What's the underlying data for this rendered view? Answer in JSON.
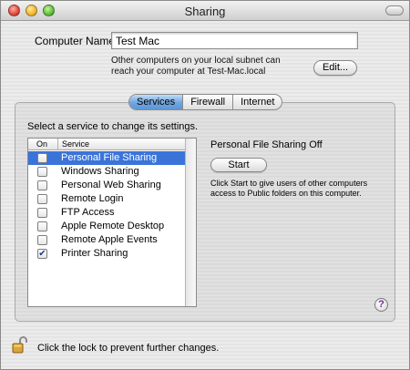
{
  "window": {
    "title": "Sharing"
  },
  "computer": {
    "label": "Computer Name:",
    "value": "Test Mac",
    "info": "Other computers on your local subnet can reach your computer at Test-Mac.local",
    "edit_label": "Edit..."
  },
  "tabs": [
    {
      "label": "Services",
      "active": true
    },
    {
      "label": "Firewall",
      "active": false
    },
    {
      "label": "Internet",
      "active": false
    }
  ],
  "services": {
    "hint": "Select a service to change its settings.",
    "col_on": "On",
    "col_service": "Service",
    "items": [
      {
        "name": "Personal File Sharing",
        "on": false,
        "selected": true
      },
      {
        "name": "Windows Sharing",
        "on": false,
        "selected": false
      },
      {
        "name": "Personal Web Sharing",
        "on": false,
        "selected": false
      },
      {
        "name": "Remote Login",
        "on": false,
        "selected": false
      },
      {
        "name": "FTP Access",
        "on": false,
        "selected": false
      },
      {
        "name": "Apple Remote Desktop",
        "on": false,
        "selected": false
      },
      {
        "name": "Remote Apple Events",
        "on": false,
        "selected": false
      },
      {
        "name": "Printer Sharing",
        "on": true,
        "selected": false
      }
    ]
  },
  "detail": {
    "status": "Personal File Sharing Off",
    "start_label": "Start",
    "description": "Click Start to give users of other computers access to Public folders on this computer."
  },
  "help": {
    "label": "?"
  },
  "lock": {
    "text": "Click the lock to prevent further changes."
  },
  "colors": {
    "selection": "#3b74d9",
    "tab_active": "#6fa5de"
  }
}
